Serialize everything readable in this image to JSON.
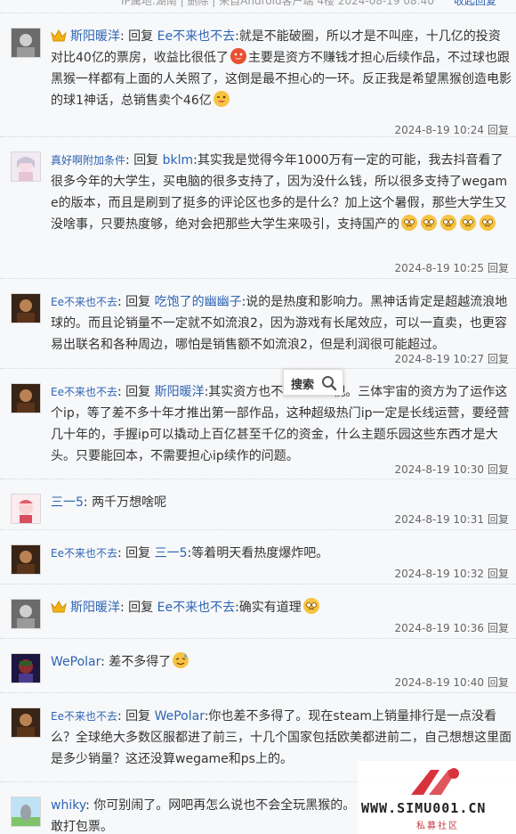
{
  "top_meta": "IP属地:湖南 | 删除 | 来自Android客户端  4楼  2024-08-19 08:40",
  "collapse_label": "收起回复",
  "reply_label": "回复",
  "search_popup_label": "搜索",
  "watermark": {
    "line1": "WWW.SIMU001.CN",
    "line2": "私募社区"
  },
  "replies": [
    {
      "user": "斯阳暖洋",
      "crown": true,
      "target": "Ee不来也不去",
      "text1": ":就是不能破圈，所以才是不叫座，十几亿的投资对比40亿的票房，收益比很低了",
      "text2": "主要是资方不赚钱才担心后续作品，不过球也跟黑猴一样都有上面的人关照了，这倒是最不担心的一环。反正我是希望黑猴创造电影的球1神话，总销售卖个46亿",
      "time": "2024-8-19 10:24"
    },
    {
      "user": "真好啊附加条件",
      "target": "bklm",
      "text1": ":其实我是觉得今年1000万有一定的可能，我去抖音看了很多今年的大学生，买电脑的很多支持了，因为没什么钱，所以很多支持了wegame的版本，而且是刷到了挺多的评论区也多的是什么？加上这个暑假，那些大学生又没啥事，只要热度够，绝对会把那些大学生来吸引，支持国产的",
      "time": "2024-8-19 10:25"
    },
    {
      "user": "Ee不来也不去",
      "target": "吃饱了的幽幽子",
      "text1": ":说的是热度和影响力。黑神话肯定是超越流浪地球的。而且论销量不一定就不如流浪2，因为游戏有长尾效应，可以一直卖，也更容易出联名和各种周边，哪怕是销售额不如流浪2，但是利润很可能超过。",
      "time": "2024-8-19 10:27"
    },
    {
      "user": "Ee不来也不去",
      "target": "斯阳暖洋",
      "text1": ":其实资方也不",
      "text2": "视。三体宇宙的资方为了运作这个ip，等了差不多十年才推出第一部作品，这种超级热门ip一定是长线运营，要经营几十年的，手握ip可以撬动上百亿甚至千亿的资金，什么主题乐园这些东西才是大头。只要能回本，不需要担心ip续作的问题。",
      "time": "2024-8-19 10:30"
    },
    {
      "user": "三一5",
      "text1": ": 两千万想啥呢",
      "time": "2024-8-19 10:31"
    },
    {
      "user": "Ee不来也不去",
      "target": "三一5",
      "text1": ":等着明天看热度爆炸吧。",
      "time": "2024-8-19 10:32"
    },
    {
      "user": "斯阳暖洋",
      "crown": true,
      "target": "Ee不来也不去",
      "text1": ":确实有道理",
      "time": "2024-8-19 10:36"
    },
    {
      "user": "WePolar",
      "text1": ": 差不多得了",
      "time": "2024-8-19 10:40"
    },
    {
      "user": "Ee不来也不去",
      "target": "WePolar",
      "text1": ":你也差不多得了。现在steam上销量排行是一点没看么？全球绝大多数区服都进了前三，十几个国家包括欧美都进前二，自己想想这里面是多少销量？这还没算wegame和ps上的。",
      "time": ""
    },
    {
      "user": "whiky",
      "text1": ": 你可别闹了。网吧再怎么说也不会全玩黑猴的。",
      "text2": "敢打包票。",
      "time": ""
    }
  ]
}
